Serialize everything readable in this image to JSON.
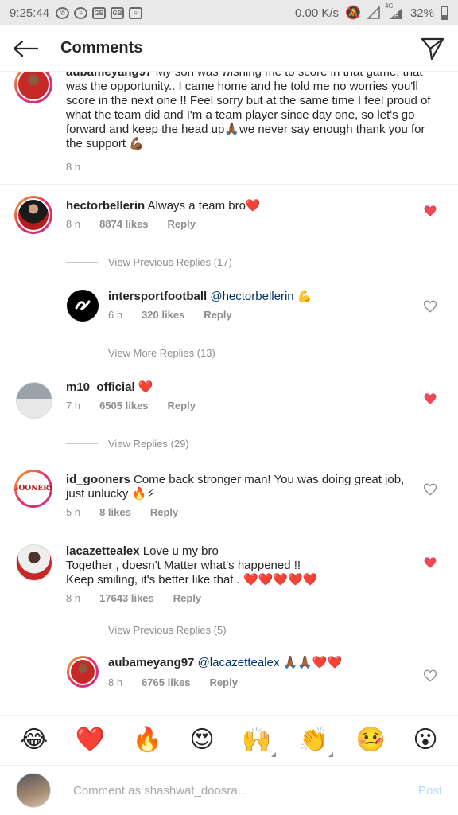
{
  "status_bar": {
    "time": "9:25:44",
    "network_speed": "0.00 K/s",
    "network_type": "4G",
    "roaming": "R",
    "battery": "32%"
  },
  "header": {
    "title": "Comments"
  },
  "comments": [
    {
      "username": "aubameyang97",
      "text": "My son was wishing me to score in that game, that was the opportunity.. I came home and he told me no worries you'll score in the next one !! Feel sorry but at the same time I feel proud of what the team did and I'm a team player since day one, so let's go forward and keep the head up🙏🏾we never say enough thank you for the support 💪🏾",
      "time": "8 h"
    },
    {
      "username": "hectorbellerin",
      "text": "Always a team bro❤️",
      "time": "8 h",
      "likes": "8874 likes",
      "reply_label": "Reply",
      "liked": true
    },
    {
      "view_replies": "View Previous Replies (17)"
    },
    {
      "username": "intersportfootball",
      "mention": "@hectorbellerin",
      "text_suffix": "💪",
      "time": "6 h",
      "likes": "320 likes",
      "reply_label": "Reply",
      "liked": false
    },
    {
      "view_replies": "View More Replies (13)"
    },
    {
      "username": "m10_official",
      "text": "❤️",
      "time": "7 h",
      "likes": "6505 likes",
      "reply_label": "Reply",
      "liked": true
    },
    {
      "view_replies": "View Replies (29)"
    },
    {
      "username": "id_gooners",
      "text": "Come back stronger man! You was doing great job, just unlucky 🔥⚡",
      "time": "5 h",
      "likes": "8 likes",
      "reply_label": "Reply",
      "liked": false
    },
    {
      "username": "lacazettealex",
      "text": "Love u my bro",
      "text_line2": "Together , doesn't Matter what's happened !!",
      "text_line3": "Keep smiling, it's better like that.. ❤️❤️❤️❤️❤️",
      "time": "8 h",
      "likes": "17643 likes",
      "reply_label": "Reply",
      "liked": true
    },
    {
      "view_replies": "View Previous Replies (5)"
    },
    {
      "username": "aubameyang97",
      "mention": "@lacazettealex",
      "text_suffix": "🙏🏾🙏🏾❤️❤️",
      "time": "8 h",
      "likes": "6765 likes",
      "reply_label": "Reply",
      "liked": false
    }
  ],
  "emoji_bar": [
    "😂",
    "❤️",
    "🔥",
    "😍",
    "🙌",
    "👏",
    "🤒",
    "😮"
  ],
  "comment_input": {
    "placeholder": "Comment as shashwat_doosra...",
    "post_label": "Post"
  },
  "colors": {
    "like_red": "#ed4956",
    "mention_blue": "#003569",
    "meta_gray": "#8e8e8e",
    "post_disabled": "#b3dbff"
  }
}
